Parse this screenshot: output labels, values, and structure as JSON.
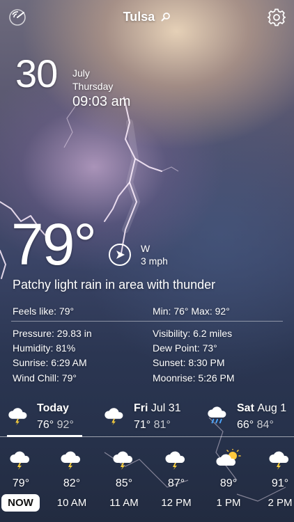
{
  "header": {
    "city": "Tulsa"
  },
  "date": {
    "day": "30",
    "month": "July",
    "weekday": "Thursday",
    "time": "09:03 am"
  },
  "current": {
    "temperature": "79°",
    "wind_direction": "W",
    "wind_speed": "3 mph",
    "condition": "Patchy light rain in area with thunder"
  },
  "details": {
    "feels_like": "Feels like: 79°",
    "min_max": "Min: 76° Max: 92°",
    "pressure": "Pressure:  29.83 in",
    "visibility": "Visibility: 6.2 miles",
    "humidity": "Humidity: 81%",
    "dew_point": "Dew Point: 73°",
    "sunrise": "Sunrise: 6:29 AM",
    "sunset": "Sunset: 8:30 PM",
    "wind_chill": "Wind Chill: 79°",
    "moonrise": "Moonrise: 5:26 PM"
  },
  "forecast": [
    {
      "day": "Today",
      "date": "",
      "high": "76°",
      "low": "92°",
      "icon": "thunderstorm-icon"
    },
    {
      "day": "Fri",
      "date": "Jul 31",
      "high": "71°",
      "low": "81°",
      "icon": "thunderstorm-icon"
    },
    {
      "day": "Sat",
      "date": "Aug 1",
      "high": "66°",
      "low": "84°",
      "icon": "rain-icon"
    }
  ],
  "hourly": [
    {
      "label": "NOW",
      "temp": "79°",
      "icon": "thunderstorm-icon"
    },
    {
      "label": "10 AM",
      "temp": "82°",
      "icon": "thunderstorm-icon"
    },
    {
      "label": "11 AM",
      "temp": "85°",
      "icon": "thunderstorm-icon"
    },
    {
      "label": "12 PM",
      "temp": "87°",
      "icon": "thunderstorm-icon"
    },
    {
      "label": "1 PM",
      "temp": "89°",
      "icon": "partly-sunny-icon"
    },
    {
      "label": "2 PM",
      "temp": "91°",
      "icon": "thunderstorm-icon"
    }
  ]
}
